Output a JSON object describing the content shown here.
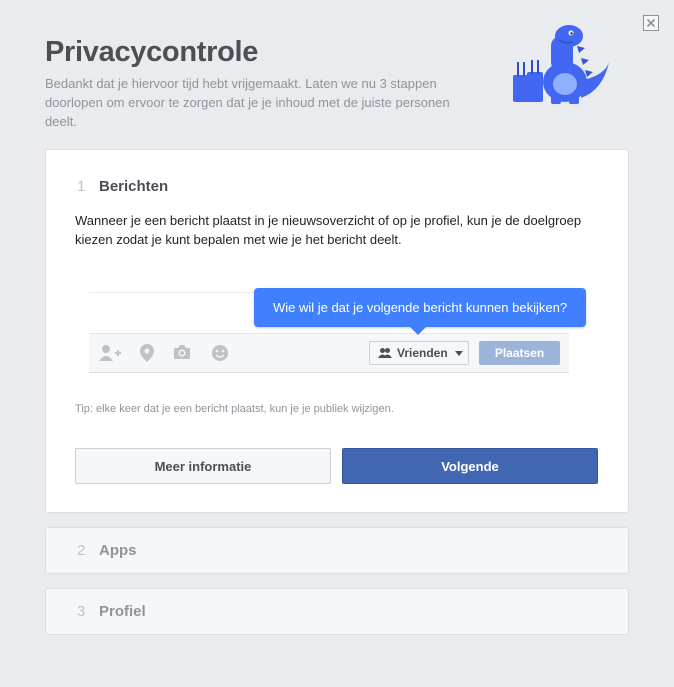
{
  "header": {
    "title": "Privacycontrole",
    "subtitle": "Bedankt dat je hiervoor tijd hebt vrijgemaakt. Laten we nu 3 stappen doorlopen om ervoor te zorgen dat je je inhoud met de juiste personen deelt."
  },
  "steps": [
    {
      "number": "1",
      "title": "Berichten"
    },
    {
      "number": "2",
      "title": "Apps"
    },
    {
      "number": "3",
      "title": "Profiel"
    }
  ],
  "step1": {
    "description": "Wanneer je een bericht plaatst in je nieuwsoverzicht of op je profiel, kun je de doelgroep kiezen zodat je kunt bepalen met wie je het bericht deelt.",
    "tooltip": "Wie wil je dat je volgende bericht kunnen bekijken?",
    "audience_label": "Vrienden",
    "post_label": "Plaatsen",
    "tip": "Tip: elke keer dat je een bericht plaatst, kun je je publiek wijzigen.",
    "more_info_label": "Meer informatie",
    "next_label": "Volgende"
  },
  "icons": {
    "close": "close-icon",
    "tag_friends": "add-person-icon",
    "location": "location-pin-icon",
    "photo": "camera-icon",
    "feeling": "smiley-icon",
    "audience": "friends-icon",
    "mascot": "dinosaur-illustration"
  },
  "colors": {
    "background": "#e9ebee",
    "primary_button": "#4267b2",
    "tooltip": "#4080ff",
    "post_button_disabled": "#9cb4d8",
    "dino": "#4267f2"
  }
}
